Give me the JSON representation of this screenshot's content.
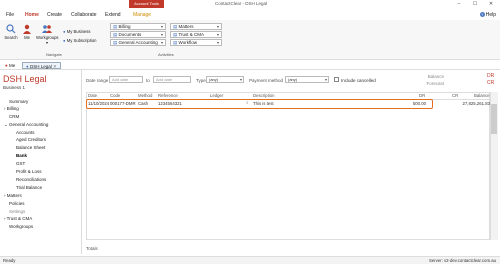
{
  "titlebar": {
    "account_tools": "Account Tools",
    "app_title": "ContactClear - DSH Legal",
    "minimize": "–",
    "maximize": "☐",
    "close": "✕"
  },
  "ribbon_tabs": [
    {
      "label": "File"
    },
    {
      "label": "Home"
    },
    {
      "label": "Create"
    },
    {
      "label": "Collaborate"
    },
    {
      "label": "Extend"
    },
    {
      "label": "Manage"
    }
  ],
  "help_label": "Help",
  "ribbon": {
    "search": "Search",
    "me": "Me",
    "workgroups": "Workgroups",
    "my_business": "My Business",
    "my_subscription": "My Subscription",
    "navigate_group": "Navigate",
    "activities_group": "Activities",
    "activities": [
      "Billing",
      "Documents",
      "General Accounting",
      "Matters",
      "Trust & CMA",
      "Workflow"
    ]
  },
  "doc_tabs": [
    {
      "label": "Me"
    },
    {
      "label": "DSH Legal"
    }
  ],
  "sidebar": {
    "title": "DSH Legal",
    "subtitle": "Business 1",
    "items": [
      {
        "label": "Summary"
      },
      {
        "label": "Billing"
      },
      {
        "label": "CRM"
      },
      {
        "label": "General Accounting"
      },
      {
        "label": "Accounts"
      },
      {
        "label": "Aged Creditors"
      },
      {
        "label": "Balance Sheet"
      },
      {
        "label": "Bank"
      },
      {
        "label": "GST"
      },
      {
        "label": "Profit & Loss"
      },
      {
        "label": "Reconciliations"
      },
      {
        "label": "Trial Balance"
      },
      {
        "label": "Matters"
      },
      {
        "label": "Policies"
      },
      {
        "label": "Settings"
      },
      {
        "label": "Trust & CMA"
      },
      {
        "label": "Workgroups"
      }
    ]
  },
  "filters": {
    "date_range_label": "Date range",
    "date_from_placeholder": "Add date",
    "to_label": "to",
    "date_to_placeholder": "Add date",
    "type_label": "Type",
    "type_value": "(any)",
    "payment_method_label": "Payment method",
    "payment_method_value": "(any)",
    "include_cancelled_label": "Include cancelled"
  },
  "balance": {
    "balance_label": "Balance",
    "forecast_label": "Forecast",
    "balance_flag": "DR",
    "forecast_flag": "CR"
  },
  "grid": {
    "columns": [
      "Date",
      "Code",
      "Method",
      "Reference",
      "Ledger",
      "Description",
      "DR",
      "CR",
      "Balance"
    ],
    "rows": [
      {
        "date": "11/10/2024",
        "code": "000177-DMR",
        "method": "Cash",
        "reference": "1234564321",
        "ledger": "",
        "description": "This is test",
        "dr": "500.00",
        "cr": "",
        "balance": "27,825,261.83"
      }
    ]
  },
  "totals_label": "Totals",
  "status": {
    "left": "Ready",
    "right": "Server: v2-dev.contactclear.com.au"
  }
}
